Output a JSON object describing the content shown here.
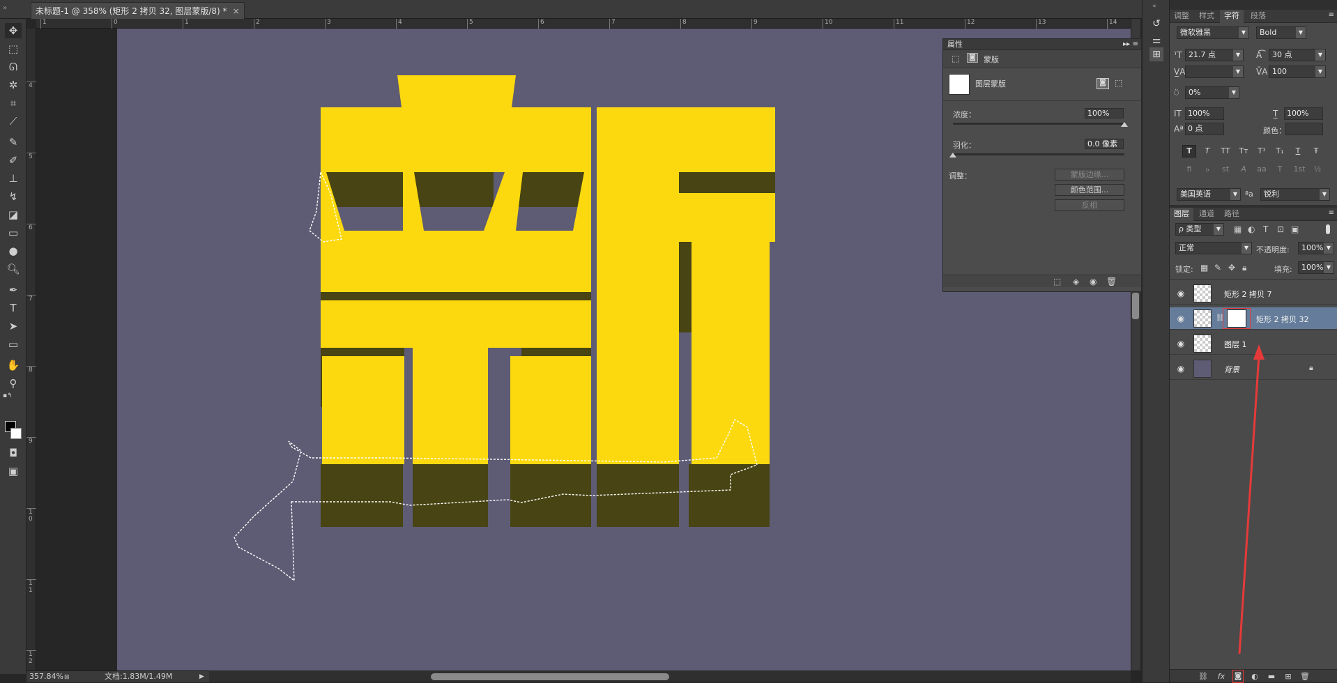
{
  "document": {
    "tab_title": "未标题-1 @ 358% (矩形 2 拷贝 32, 图层蒙版/8) *",
    "close_glyph": "×"
  },
  "rulers": {
    "top_labels": [
      "1",
      "0",
      "1",
      "2",
      "3",
      "4",
      "5",
      "6",
      "7",
      "8",
      "9",
      "10",
      "11",
      "12",
      "13",
      "14"
    ],
    "left_labels": [
      "4",
      "5",
      "6",
      "7",
      "8",
      "9",
      "1\n0",
      "1\n1",
      "1\n2"
    ]
  },
  "canvas": {
    "background": "#5e5c74",
    "glyph": "新",
    "glyph_color": "#fcd90e",
    "shadow_color": "#484413"
  },
  "status": {
    "zoom": "357.84%",
    "doc_info": "文档:1.83M/1.49M"
  },
  "properties": {
    "title": "属性",
    "mask_type": "蒙版",
    "mask_label": "图层蒙版",
    "density_label": "浓度：",
    "density_value": "100%",
    "density_fraction": 1.0,
    "feather_label": "羽化：",
    "feather_value": "0.0 像素",
    "feather_fraction": 0.0,
    "adjust_label": "调整：",
    "btn_mask_edge": "蒙版边缘...",
    "btn_color_range": "颜色范围...",
    "btn_invert": "反相"
  },
  "char_panel": {
    "tabs": [
      "调整",
      "样式",
      "字符",
      "段落"
    ],
    "active_tab": "字符",
    "font_family": "微软雅黑",
    "font_style": "Bold",
    "font_size": "21.7 点",
    "leading": "30 点",
    "kerning": "",
    "tracking": "100",
    "tsume": "0%",
    "vertical_scale": "100%",
    "horizontal_scale": "100%",
    "baseline_shift": "0 点",
    "color_label": "颜色：",
    "style_buttons": [
      "T",
      "T",
      "TT",
      "Tт",
      "T¹",
      "T₁",
      "T",
      "Ŧ"
    ],
    "opentype_buttons": [
      "fi",
      "ℴ",
      "st",
      "A",
      "aa",
      "T",
      "1st",
      "½"
    ],
    "language": "美国英语",
    "aa_label": "ªa",
    "antialias": "锐利"
  },
  "layers_panel": {
    "tabs": [
      "图层",
      "通道",
      "路径"
    ],
    "active_tab": "图层",
    "filter_kind": "ρ 类型",
    "blend_mode": "正常",
    "opacity_label": "不透明度:",
    "opacity_value": "100%",
    "lock_label": "锁定:",
    "fill_label": "填充:",
    "fill_value": "100%",
    "layers": [
      {
        "name": "矩形 2 拷贝 7",
        "selected": false,
        "has_mask": false
      },
      {
        "name": "矩形 2 拷贝 32",
        "selected": true,
        "has_mask": true
      },
      {
        "name": "图层 1",
        "selected": false,
        "has_mask": false
      },
      {
        "name": "背景",
        "selected": false,
        "has_mask": false,
        "locked": true
      }
    ],
    "footer_buttons": [
      "link-icon",
      "fx-icon",
      "add-mask-icon",
      "adjustment-icon",
      "folder-icon",
      "new-layer-icon",
      "trash-icon"
    ],
    "highlight_color": "#e63a3a"
  }
}
